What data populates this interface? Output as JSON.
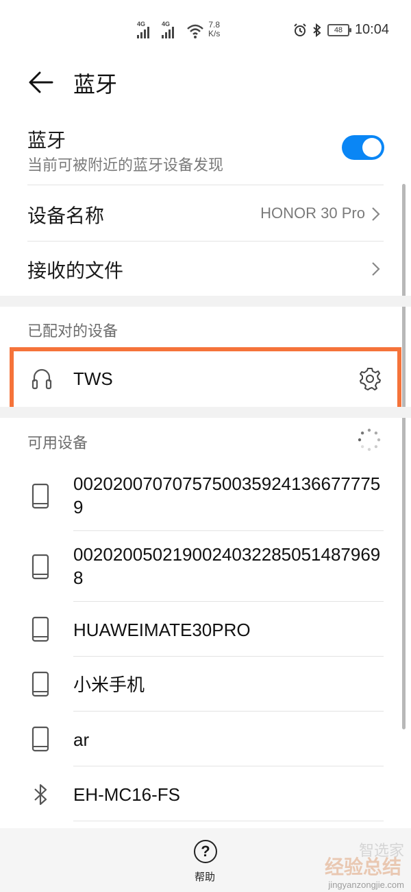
{
  "status_bar": {
    "network_1": "4G",
    "network_2": "4G",
    "speed_value": "7.8",
    "speed_unit": "K/s",
    "battery": "48",
    "time": "10:04"
  },
  "header": {
    "title": "蓝牙"
  },
  "bluetooth": {
    "title": "蓝牙",
    "subtitle": "当前可被附近的蓝牙设备发现",
    "enabled": true,
    "accent": "#0a86f5"
  },
  "device_name": {
    "label": "设备名称",
    "value": "HONOR 30 Pro"
  },
  "received_files": {
    "label": "接收的文件"
  },
  "paired": {
    "section_label": "已配对的设备",
    "devices": [
      {
        "name": "TWS",
        "icon": "headphones-icon"
      }
    ]
  },
  "available": {
    "section_label": "可用设备",
    "devices": [
      {
        "name": "00202007070757500359241366777759",
        "icon": "phone-icon"
      },
      {
        "name": "00202005021900240322850514879698",
        "icon": "phone-icon"
      },
      {
        "name": "HUAWEIMATE30PRO",
        "icon": "phone-icon"
      },
      {
        "name": "小米手机",
        "icon": "phone-icon"
      },
      {
        "name": "ar",
        "icon": "phone-icon"
      },
      {
        "name": "EH-MC16-FS",
        "icon": "bluetooth-icon"
      }
    ]
  },
  "bottom": {
    "help_label": "帮助",
    "help_glyph": "?"
  },
  "watermark": {
    "text": "经验总结",
    "brand": "智选家",
    "url": "jingyanzongjie.com"
  },
  "highlight_color": "#f5733a"
}
